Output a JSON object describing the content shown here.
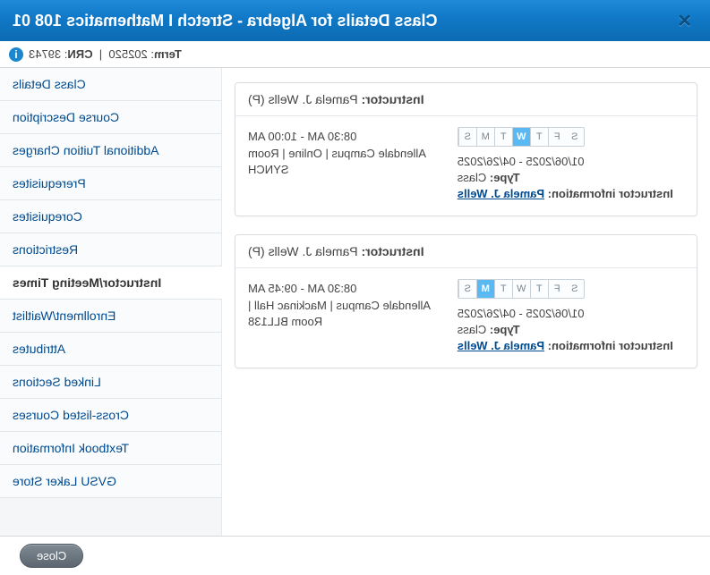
{
  "header": {
    "title": "Class Details for Algebra - Stretch I Mathematics 108 01"
  },
  "infobar": {
    "term_label": "Term",
    "term_value": "202520",
    "crn_label": "CRN",
    "crn_value": "39743"
  },
  "sidebar": {
    "items": [
      {
        "label": "Class Details"
      },
      {
        "label": "Course Description"
      },
      {
        "label": "Additional Tuition Charges"
      },
      {
        "label": "Prerequisites"
      },
      {
        "label": "Corequisites"
      },
      {
        "label": "Restrictions"
      },
      {
        "label": "Instructor/Meeting Times"
      },
      {
        "label": "Enrollment/Waitlist"
      },
      {
        "label": "Attributes"
      },
      {
        "label": "Linked Sections"
      },
      {
        "label": "Cross-listed Courses"
      },
      {
        "label": "Textbook Information"
      },
      {
        "label": "GVSU Laker Store"
      }
    ],
    "active_index": 6
  },
  "meetings": [
    {
      "instructor_label": "Instructor:",
      "instructor_name": "Pamela J. Wells (P)",
      "active_days": [
        "W"
      ],
      "time": "08:30 AM - 10:00 AM",
      "dates": "01/06/2025 - 04/26/2025",
      "location": "Allendale Campus | Online | Room SYNCH",
      "type_label": "Type:",
      "type_value": "Class",
      "instructor_info_label": "Instructor information:",
      "instructor_link": "Pamela J. Wells"
    },
    {
      "instructor_label": "Instructor:",
      "instructor_name": "Pamela J. Wells (P)",
      "active_days": [
        "M"
      ],
      "time": "08:30 AM - 09:45 AM",
      "dates": "01/06/2025 - 04/26/2025",
      "location": "Allendale Campus | Mackinac Hall | Room BLL138",
      "type_label": "Type:",
      "type_value": "Class",
      "instructor_info_label": "Instructor information:",
      "instructor_link": "Pamela J. Wells"
    }
  ],
  "days_of_week": [
    "S",
    "M",
    "T",
    "W",
    "T",
    "F",
    "S"
  ],
  "days_keys": [
    "U",
    "M",
    "T",
    "W",
    "R",
    "F",
    "S"
  ],
  "footer": {
    "close_label": "Close"
  }
}
